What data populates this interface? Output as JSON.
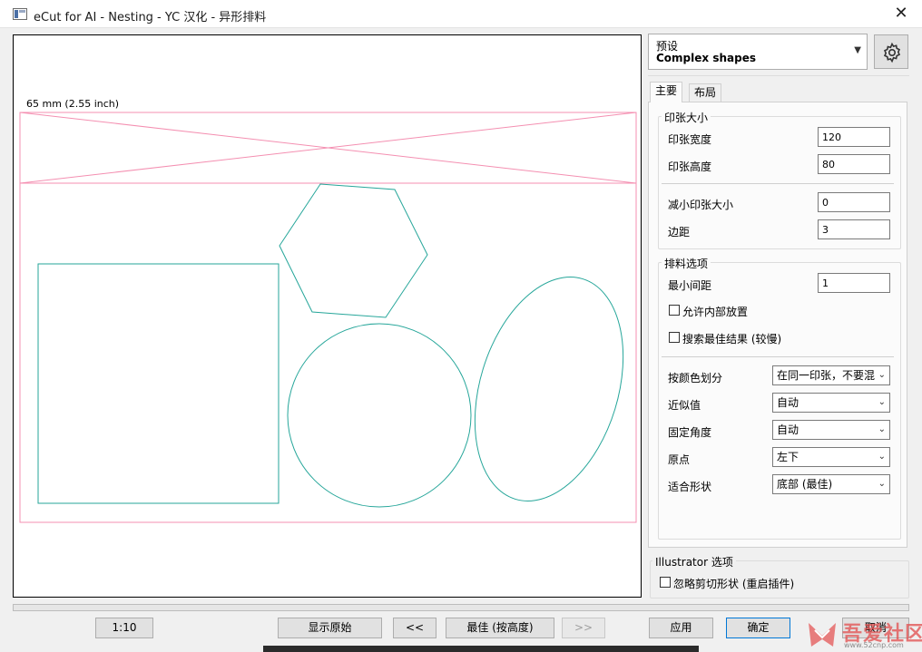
{
  "window": {
    "title": "eCut for AI - Nesting - YC 汉化 - 异形排料",
    "close_glyph": "✕"
  },
  "canvas": {
    "dimension_label": "65 mm (2.55 inch)",
    "colors": {
      "sheet": "#f48fb1",
      "shapes": "#26a69a"
    }
  },
  "preset": {
    "label": "预设",
    "value": "Complex shapes",
    "icon": "gear-icon"
  },
  "tabs": [
    {
      "label": "主要",
      "active": true
    },
    {
      "label": "布局",
      "active": false
    }
  ],
  "sheet_size": {
    "title": "印张大小",
    "fields": [
      {
        "label": "印张宽度",
        "value": "120"
      },
      {
        "label": "印张高度",
        "value": "80"
      },
      {
        "label": "减小印张大小",
        "value": "0"
      },
      {
        "label": "边距",
        "value": "3"
      }
    ]
  },
  "nesting_options": {
    "title": "排料选项",
    "min_gap": {
      "label": "最小间距",
      "value": "1"
    },
    "checkboxes": [
      {
        "label": "允许内部放置",
        "checked": false
      },
      {
        "label": "搜索最佳结果 (较慢)",
        "checked": false
      }
    ],
    "dropdowns": [
      {
        "label": "按颜色划分",
        "value": "在同一印张，不要混"
      },
      {
        "label": "近似值",
        "value": "自动"
      },
      {
        "label": "固定角度",
        "value": "自动"
      },
      {
        "label": "原点",
        "value": "左下"
      },
      {
        "label": "适合形状",
        "value": "底部 (最佳)"
      }
    ]
  },
  "illustrator": {
    "title": "Illustrator 选项",
    "checkbox": {
      "label": "忽略剪切形状 (重启插件)",
      "checked": false
    }
  },
  "buttons": {
    "scale": "1:10",
    "show_original": "显示原始",
    "prev": "<<",
    "best": "最佳 (按高度)",
    "next": ">>",
    "apply": "应用",
    "ok": "确定",
    "cancel": "取消"
  },
  "watermark": {
    "text": "吾爱社区",
    "sub": "www.52cnp.com"
  }
}
